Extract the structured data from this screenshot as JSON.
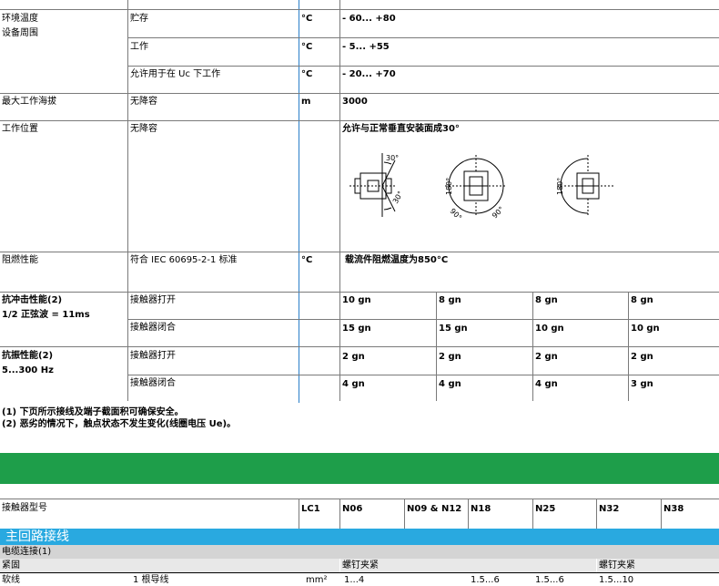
{
  "env": {
    "label1": "环境温度",
    "label2": "设备周围",
    "rows": [
      {
        "condition": "贮存",
        "unit": "°C",
        "value": "- 60... +80"
      },
      {
        "condition": "工作",
        "unit": "°C",
        "value": "- 5... +55"
      },
      {
        "condition": "允许用于在 Uc 下工作",
        "unit": "°C",
        "value": "- 20... +70"
      }
    ]
  },
  "altitude": {
    "label": "最大工作海拔",
    "condition": "无降容",
    "unit": "m",
    "value": "3000"
  },
  "position": {
    "label": "工作位置",
    "condition": "无降容",
    "value": "允许与正常垂直安装面成30°",
    "angle_labels": {
      "a30_top": "30°",
      "a30_bottom": "30°",
      "a180": "180°",
      "a90_left": "90°",
      "a90_right": "90°",
      "a180_b": "180°"
    }
  },
  "flame": {
    "label": "阻燃性能",
    "condition": "符合 IEC 60695-2-1 标准",
    "unit": "°C",
    "value": "载流件阻燃温度为850°C"
  },
  "shock": {
    "label1": "抗冲击性能(2)",
    "label2": "1/2 正弦波 = 11ms",
    "rows": [
      {
        "condition": "接触器打开",
        "values": [
          "10 gn",
          "8 gn",
          "8 gn",
          "8 gn"
        ]
      },
      {
        "condition": "接触器闭合",
        "values": [
          "15 gn",
          "15 gn",
          "10 gn",
          "10 gn"
        ]
      }
    ]
  },
  "vibration": {
    "label1": "抗振性能(2)",
    "label2": "5...300 Hz",
    "rows": [
      {
        "condition": "接触器打开",
        "values": [
          "2 gn",
          "2 gn",
          "2 gn",
          "2 gn"
        ]
      },
      {
        "condition": "接触器闭合",
        "values": [
          "4 gn",
          "4 gn",
          "4 gn",
          "3 gn"
        ]
      }
    ]
  },
  "notes": [
    "(1) 下页所示接线及端子截面积可确保安全。",
    "(2) 恶劣的情况下，触点状态不发生变化(线圈电压 Ue)。"
  ],
  "contactor": {
    "label": "接触器型号",
    "prefix": "LC1",
    "models": [
      "N06",
      "N09 & N12",
      "N18",
      "N25",
      "N32",
      "N38"
    ]
  },
  "main_circuit": {
    "title": "主回路接线",
    "cable": "电缆连接(1)",
    "tighten": "紧固",
    "screw1": "螺钉夹紧",
    "screw2": "螺钉夹紧"
  },
  "partial_row": {
    "label": "软线",
    "condition": "1 根导线",
    "unit": "mm²",
    "values": [
      "1...4",
      "1.5...6",
      "1.5...6",
      "1.5...10"
    ]
  }
}
